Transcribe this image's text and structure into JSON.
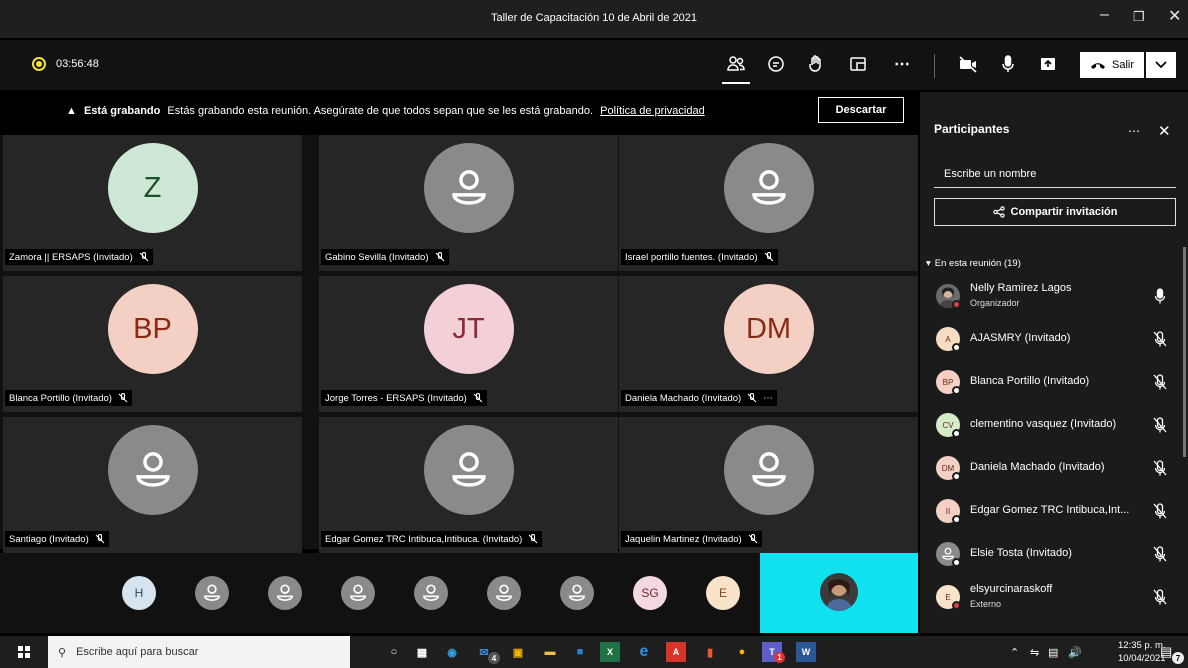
{
  "window": {
    "title": "Taller de Capacitación 10 de Abril de 2021"
  },
  "toolbar": {
    "timer": "03:56:48",
    "leave_label": "Salir"
  },
  "banner": {
    "title": "Está grabando",
    "message": "Estás grabando esta reunión. Asegúrate de que todos sepan que se les está grabando.",
    "link": "Política de privacidad",
    "dismiss_label": "Descartar"
  },
  "grid": {
    "tiles": [
      {
        "name": "Zamora || ERSAPS (Invitado)",
        "initials": "Z",
        "bg": "#cfe8d5",
        "fg": "#1d4e2c"
      },
      {
        "name": "Gabino Sevilla (Invitado)",
        "initials": "",
        "bg": "#8a8a8a",
        "fg": "#ffffff"
      },
      {
        "name": "Israel portillo fuentes. (Invitado)",
        "initials": "",
        "bg": "#8a8a8a",
        "fg": "#ffffff"
      },
      {
        "name": "Blanca Portillo (Invitado)",
        "initials": "BP",
        "bg": "#f4cfc4",
        "fg": "#8a2a12"
      },
      {
        "name": "Jorge Torres - ERSAPS (Invitado)",
        "initials": "JT",
        "bg": "#f3cfd6",
        "fg": "#8a2a36"
      },
      {
        "name": "Daniela Machado (Invitado)",
        "initials": "DM",
        "bg": "#f4cfc4",
        "fg": "#8a2a12"
      },
      {
        "name": "Santiago (Invitado)",
        "initials": "",
        "bg": "#8a8a8a",
        "fg": "#ffffff"
      },
      {
        "name": "Edgar Gomez TRC Intibuca,Intibuca. (Invitado)",
        "initials": "",
        "bg": "#8a8a8a",
        "fg": "#ffffff"
      },
      {
        "name": "Jaquelin Martinez (Invitado)",
        "initials": "",
        "bg": "#8a8a8a",
        "fg": "#ffffff"
      }
    ]
  },
  "strip": {
    "items": [
      {
        "initials": "H",
        "bg": "#d6e4f0",
        "fg": "#2c4a66"
      },
      {
        "initials": "",
        "bg": "#8a8a8a",
        "fg": "#ffffff"
      },
      {
        "initials": "",
        "bg": "#8a8a8a",
        "fg": "#ffffff"
      },
      {
        "initials": "",
        "bg": "#8a8a8a",
        "fg": "#ffffff"
      },
      {
        "initials": "",
        "bg": "#8a8a8a",
        "fg": "#ffffff"
      },
      {
        "initials": "",
        "bg": "#8a8a8a",
        "fg": "#ffffff"
      },
      {
        "initials": "",
        "bg": "#8a8a8a",
        "fg": "#ffffff"
      },
      {
        "initials": "SG",
        "bg": "#f3d9df",
        "fg": "#6b2a36"
      },
      {
        "initials": "E",
        "bg": "#f9e3c9",
        "fg": "#8a4a12"
      }
    ]
  },
  "panel": {
    "title": "Participantes",
    "search_placeholder": "Escribe un nombre",
    "share_label": "Compartir invitación",
    "section_label": "En esta reunión (19)",
    "participants": [
      {
        "name": "Nelly Ramirez Lagos",
        "role": "Organizador",
        "initials": "",
        "bg": "#6b6b6b",
        "mic": "on"
      },
      {
        "name": "AJASMRY (Invitado)",
        "role": "",
        "initials": "A",
        "bg": "#f9dcc4",
        "mic": "off"
      },
      {
        "name": "Blanca Portillo (Invitado)",
        "role": "",
        "initials": "BP",
        "bg": "#f4cfc4",
        "mic": "off"
      },
      {
        "name": "clementino vasquez (Invitado)",
        "role": "",
        "initials": "CV",
        "bg": "#d5ecc9",
        "mic": "off"
      },
      {
        "name": "Daniela Machado (Invitado)",
        "role": "",
        "initials": "DM",
        "bg": "#f4cfc4",
        "mic": "off"
      },
      {
        "name": "Edgar Gomez TRC Intibuca,Int...",
        "role": "",
        "initials": "II",
        "bg": "#f4cfc4",
        "mic": "off"
      },
      {
        "name": "Elsie Tosta (Invitado)",
        "role": "",
        "initials": "",
        "bg": "#8a8a8a",
        "mic": "off"
      },
      {
        "name": "elsyurcinaraskoff",
        "role": "Externo",
        "initials": "E",
        "bg": "#f9e3c9",
        "mic": "off"
      }
    ]
  },
  "taskbar": {
    "search_placeholder": "Escribe aquí para buscar",
    "time": "12:35 p. m.",
    "date": "10/04/2021",
    "mail_badge": "4",
    "teams_badge": "1",
    "notif_badge": "7"
  }
}
